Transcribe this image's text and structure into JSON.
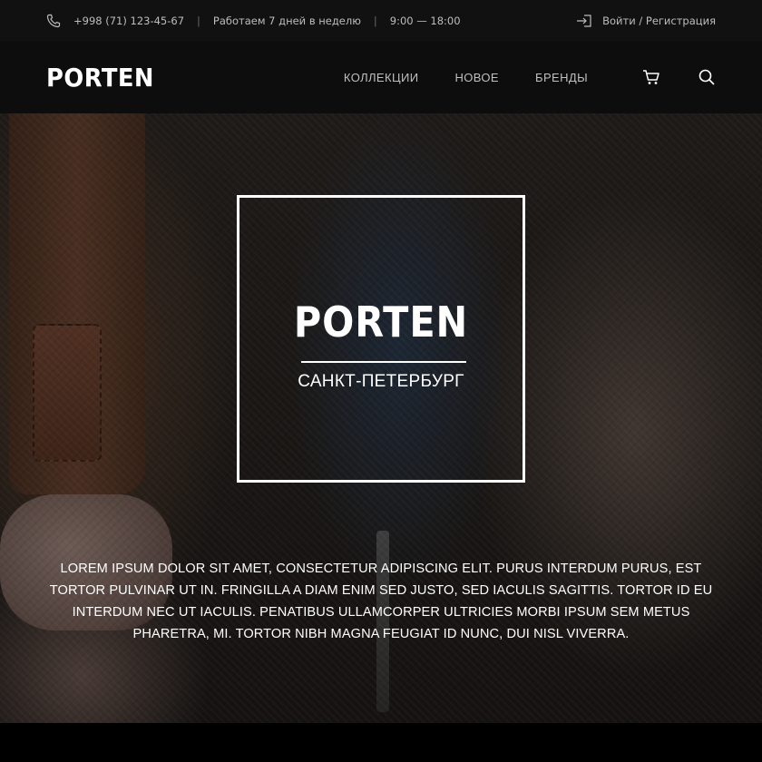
{
  "topbar": {
    "phone": "+998 (71) 123-45-67",
    "workdays": "Работаем 7 дней в неделю",
    "hours": "9:00 — 18:00",
    "separator": "|",
    "login": "Войти / Регистрация"
  },
  "header": {
    "logo": "PORTEN",
    "nav": [
      {
        "label": "КОЛЛЕКЦИИ"
      },
      {
        "label": "НОВОЕ"
      },
      {
        "label": "БРЕНДЫ"
      }
    ],
    "icons": [
      "cart-icon",
      "search-icon"
    ]
  },
  "hero": {
    "logo": "PORTEN",
    "city": "САНКТ-ПЕТЕРБУРГ",
    "text": "Lorem ipsum dolor sit amet, consectetur adipiscing elit. Purus interdum purus, est tortor pulvinar ut in. Fringilla a diam enim sed justo, sed iaculis sagittis. Tortor id eu interdum nec ut iaculis. Penatibus ullamcorper ultricies morbi ipsum sem metus pharetra, mi. Tortor nibh magna feugiat id nunc, dui nisl viverra."
  },
  "colors": {
    "topbar_bg": "#111112",
    "header_bg": "#0d0d0d",
    "text_muted": "#bdbdbd",
    "white": "#ffffff"
  }
}
